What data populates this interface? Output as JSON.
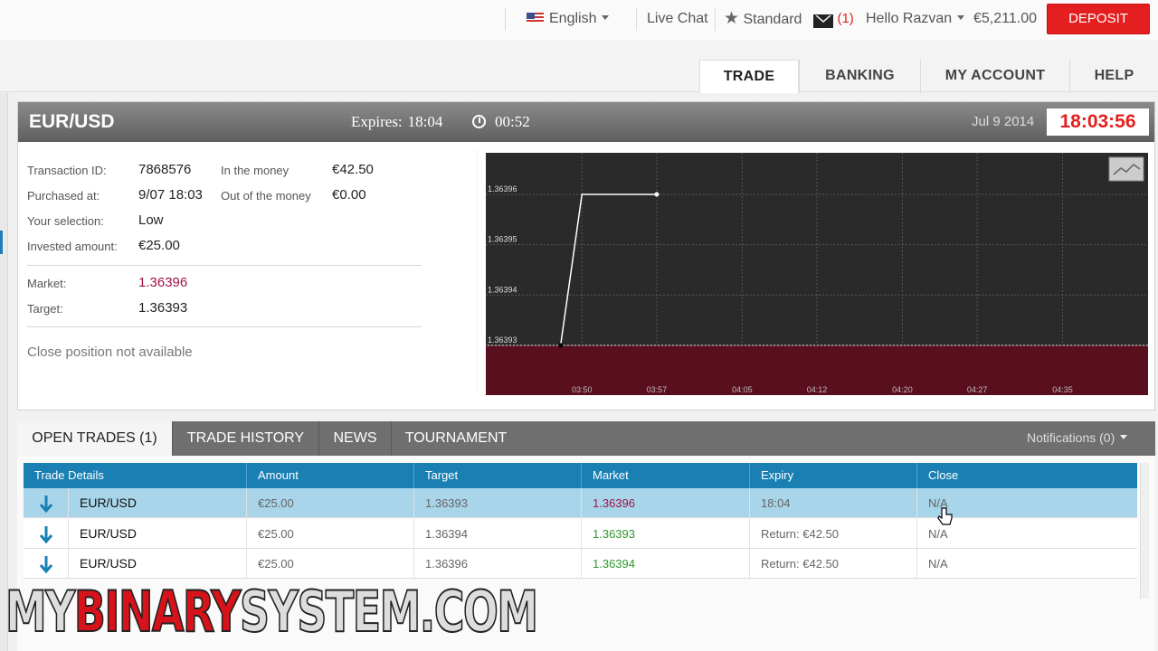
{
  "topbar": {
    "language": "English",
    "live_chat": "Live Chat",
    "account_type": "Standard",
    "messages_count": "(1)",
    "greeting": "Hello Razvan",
    "balance": "€5,211.00",
    "deposit": "DEPOSIT"
  },
  "nav": {
    "tabs": [
      "TRADE",
      "BANKING",
      "MY ACCOUNT",
      "HELP"
    ]
  },
  "trade": {
    "pair": "EUR/USD",
    "expires_label": "Expires:",
    "expires_value": "18:04",
    "countdown": "00:52",
    "date": "Jul 9 2014",
    "clock": "18:03:56",
    "details": {
      "transaction_id_label": "Transaction ID:",
      "transaction_id": "7868576",
      "purchased_label": "Purchased at:",
      "purchased": "9/07 18:03",
      "selection_label": "Your selection:",
      "selection": "Low",
      "invested_label": "Invested amount:",
      "invested": "€25.00",
      "in_money_label": "In the money",
      "in_money": "€42.50",
      "out_money_label": "Out of the money",
      "out_money": "€0.00",
      "market_label": "Market:",
      "market": "1.36396",
      "target_label": "Target:",
      "target": "1.36393",
      "close_note": "Close position not available"
    }
  },
  "chart_data": {
    "type": "line",
    "x": [
      "03:48",
      "03:50",
      "03:57"
    ],
    "values": [
      1.36393,
      1.36396,
      1.36396
    ],
    "yticks": [
      "1.36396",
      "1.36395",
      "1.36394",
      "1.36393"
    ],
    "ylim": [
      1.36392,
      1.36397
    ],
    "xticks": [
      "03:50",
      "03:57",
      "04:05",
      "04:12",
      "04:20",
      "04:27",
      "04:35"
    ],
    "target": 1.36393,
    "colors": {
      "background": "#2a2a2a",
      "losing_zone": "#5a0f1e",
      "line": "#ffffff"
    }
  },
  "bottom": {
    "tabs": [
      "OPEN TRADES (1)",
      "TRADE HISTORY",
      "NEWS",
      "TOURNAMENT"
    ],
    "notifications": "Notifications (0)",
    "columns": [
      "Trade Details",
      "Amount",
      "Target",
      "Market",
      "Expiry",
      "Close"
    ],
    "rows": [
      {
        "pair": "EUR/USD",
        "amount": "€25.00",
        "target": "1.36393",
        "market": "1.36396",
        "expiry": "18:04",
        "close": "N/A",
        "market_color": "#a0134a"
      },
      {
        "pair": "EUR/USD",
        "amount": "€25.00",
        "target": "1.36394",
        "market": "1.36393",
        "expiry": "Return: €42.50",
        "close": "N/A",
        "market_color": "#2c9a2c"
      },
      {
        "pair": "EUR/USD",
        "amount": "€25.00",
        "target": "1.36396",
        "market": "1.36394",
        "expiry": "Return: €42.50",
        "close": "N/A",
        "market_color": "#2c9a2c"
      }
    ]
  },
  "watermark": {
    "part1": "MY",
    "part2": "BINARY",
    "part3": "SYSTEM.COM"
  },
  "icons": [
    "us-flag-icon",
    "star-icon",
    "mail-icon",
    "timer-icon",
    "chart-toggle-icon",
    "down-arrow-icon",
    "cursor-hand-icon"
  ]
}
